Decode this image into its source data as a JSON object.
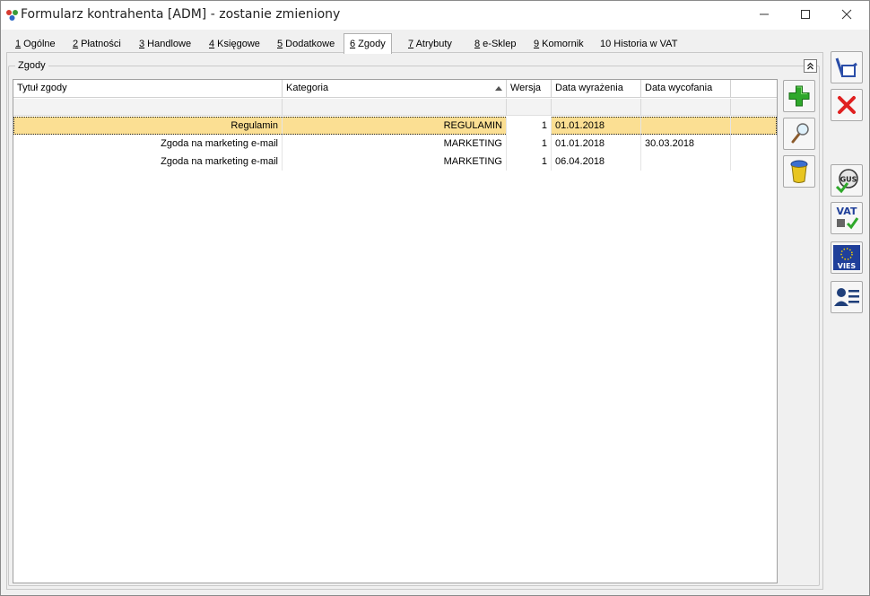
{
  "window": {
    "title": "Formularz kontrahenta [ADM] - zostanie zmieniony"
  },
  "tabs": [
    {
      "key": "1",
      "label": " Ogólne"
    },
    {
      "key": "2",
      "label": " Płatności"
    },
    {
      "key": "3",
      "label": " Handlowe"
    },
    {
      "key": "4",
      "label": " Księgowe"
    },
    {
      "key": "5",
      "label": " Dodatkowe"
    },
    {
      "key": "6",
      "label": " Zgody"
    },
    {
      "key": "7",
      "label": " Atrybuty"
    },
    {
      "key": "8",
      "label": " e-Sklep"
    },
    {
      "key": "9",
      "label": " Komornik"
    },
    {
      "key": "10",
      "label": " Historia w VAT"
    }
  ],
  "active_tab": "6",
  "group": {
    "title": "Zgody"
  },
  "grid": {
    "columns": {
      "tytul": "Tytuł zgody",
      "kategoria": "Kategoria",
      "wersja": "Wersja",
      "data_wyrazenia": "Data wyrażenia",
      "data_wycofania": "Data wycofania"
    },
    "sort_column": "Kategoria",
    "rows": [
      {
        "tytul": "Regulamin",
        "kategoria": "REGULAMIN",
        "wersja": "1",
        "data_wyrazenia": "01.01.2018",
        "data_wycofania": ""
      },
      {
        "tytul": "Zgoda na marketing e-mail",
        "kategoria": "MARKETING",
        "wersja": "1",
        "data_wyrazenia": "01.01.2018",
        "data_wycofania": "30.03.2018"
      },
      {
        "tytul": "Zgoda na marketing e-mail",
        "kategoria": "MARKETING",
        "wersja": "1",
        "data_wyrazenia": "06.04.2018",
        "data_wycofania": ""
      }
    ]
  },
  "icons": {
    "add": "plus-icon",
    "edit": "magnifier-icon",
    "delete": "trash-icon",
    "save": "save-check-icon",
    "cancel": "close-x-icon",
    "gus": "gus-icon",
    "vat": "vat-check-icon",
    "vies": "vies-icon",
    "contact": "contact-card-icon"
  },
  "side_labels": {
    "gus": "GUS",
    "vat": "VAT",
    "vies": "VIES"
  },
  "colors": {
    "selected_row": "#fbdf93",
    "add_green": "#2fa82b",
    "cancel_red": "#e02020",
    "vies_blue": "#1f3f9a"
  }
}
